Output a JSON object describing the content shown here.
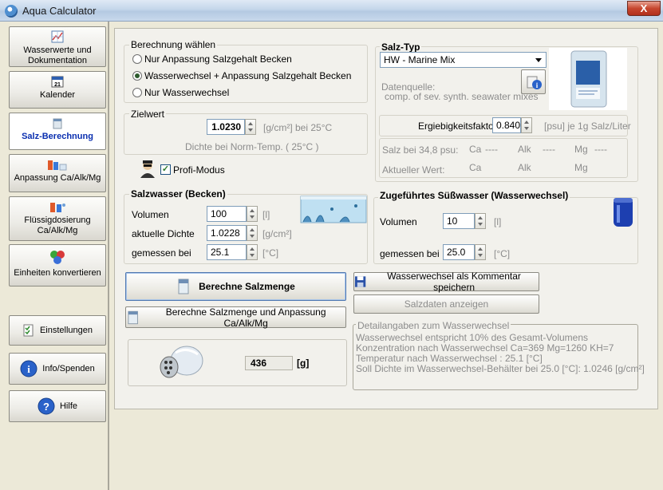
{
  "window": {
    "title": "Aqua Calculator",
    "close_label": "X"
  },
  "sidebar": {
    "items": [
      {
        "label": "Wasserwerte und Dokumentation",
        "icon": "chart-icon"
      },
      {
        "label": "Kalender",
        "icon": "calendar-icon"
      },
      {
        "label": "Salz-Berechnung",
        "icon": "salt-icon",
        "active": true
      },
      {
        "label": "Anpassung Ca/Alk/Mg",
        "icon": "bottles-icon"
      },
      {
        "label": "Flüssigdosierung Ca/Alk/Mg",
        "icon": "dosing-icon"
      },
      {
        "label": "Einheiten konvertieren",
        "icon": "convert-icon"
      },
      {
        "label": "Einstellungen",
        "icon": "settings-icon"
      },
      {
        "label": "Info/Spenden",
        "icon": "info-icon"
      },
      {
        "label": "Hilfe",
        "icon": "help-icon"
      }
    ]
  },
  "calc_mode": {
    "title": "Berechnung wählen",
    "options": [
      "Nur Anpassung Salzgehalt Becken",
      "Wasserwechsel + Anpassung Salzgehalt Becken",
      "Nur Wasserwechsel"
    ],
    "selected_index": 1
  },
  "target": {
    "title": "Zielwert",
    "value": "1.0230",
    "unit": "[g/cm²] bei 25°C",
    "note": "Dichte bei Norm-Temp. ( 25°C )"
  },
  "profi": {
    "label": "Profi-Modus",
    "checked": true
  },
  "salt_type": {
    "title": "Salz-Typ",
    "selected": "HW - Marine Mix",
    "source_label": "Datenquelle:",
    "source_value": "comp. of sev. synth. seawater mixes",
    "yield_label": "Ergiebigkeitsfaktor",
    "yield_value": "0.840",
    "yield_unit": "[psu] je 1g Salz/Liter",
    "row1_label": "Salz bei 34,8 psu:",
    "row2_label": "Aktueller Wert:",
    "ca": "Ca",
    "alk": "Alk",
    "mg": "Mg",
    "dash": "----"
  },
  "saltwater": {
    "title": "Salzwasser (Becken)",
    "volume_label": "Volumen",
    "volume_value": "100",
    "volume_unit": "[l]",
    "density_label": "aktuelle Dichte",
    "density_value": "1.0228",
    "density_unit": "[g/cm²]",
    "measured_label": "gemessen bei",
    "measured_value": "25.1",
    "measured_unit": "[°C]"
  },
  "freshwater": {
    "title": "Zugeführtes Süßwasser (Wasserwechsel)",
    "volume_label": "Volumen",
    "volume_value": "10",
    "volume_unit": "[l]",
    "measured_label": "gemessen bei",
    "measured_value": "25.0",
    "measured_unit": "[°C]"
  },
  "actions": {
    "calc_salt": "Berechne Salzmenge",
    "calc_salt_adjust": "Berechne Salzmenge und Anpassung Ca/Alk/Mg",
    "save_comment": "Wasserwechsel als Kommentar speichern",
    "show_salt": "Salzdaten anzeigen"
  },
  "result": {
    "value": "436",
    "unit": "[g]"
  },
  "details": {
    "title": "Detailangaben zum Wasserwechsel",
    "lines": [
      "Wasserwechsel entspricht 10%  des Gesamt-Volumens",
      "Konzentration nach Wasserwechsel Ca=369 Mg=1260 KH=7",
      "Temperatur nach Wasserwechsel : 25.1 [°C]",
      "Soll Dichte im Wasserwechsel-Behälter bei 25.0 [°C]: 1.0246 [g/cm²]"
    ]
  }
}
